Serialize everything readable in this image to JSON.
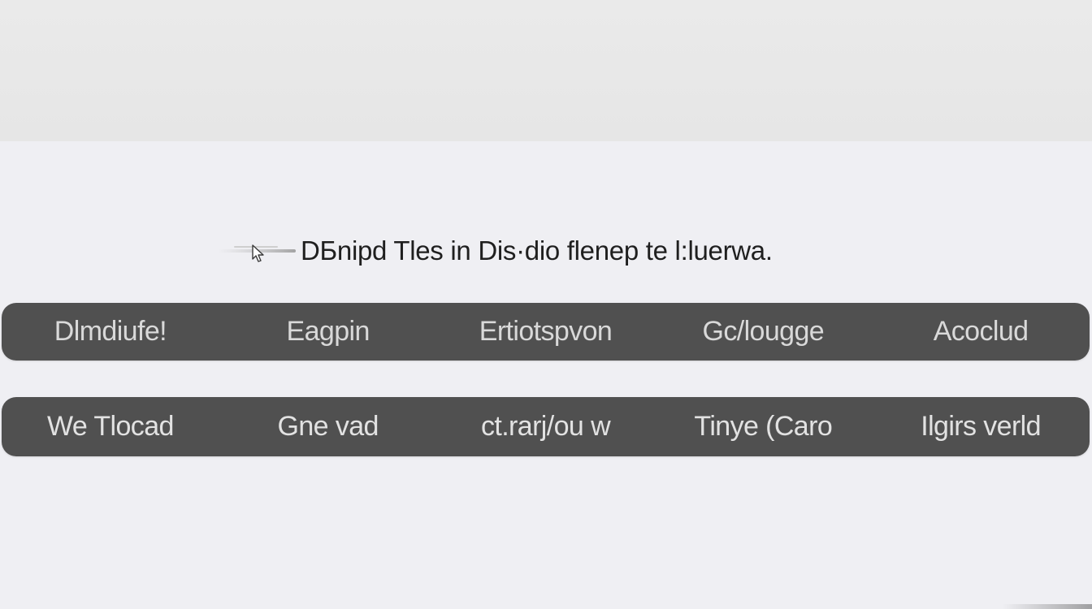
{
  "instruction": {
    "text": "DБnipd Tles in Dis·dio flenep te l:luerwa.",
    "icon": "mouse-cursor-icon"
  },
  "rows": [
    {
      "items": [
        "Dlmdiufe!",
        "Eagpin",
        "Ertiotspvon",
        "Gc/lougge",
        "Acoclud"
      ]
    },
    {
      "items": [
        "We Tlocad",
        "Gne vad",
        "ct.rarj/ou w",
        "Tinye (Caro",
        "Ilgirs verld"
      ]
    }
  ],
  "colors": {
    "top_band": "#e8e8e8",
    "background": "#efeff3",
    "row_background": "#505050",
    "row_text": "#d9d9d9",
    "instruction_text": "#1f1f1f"
  }
}
